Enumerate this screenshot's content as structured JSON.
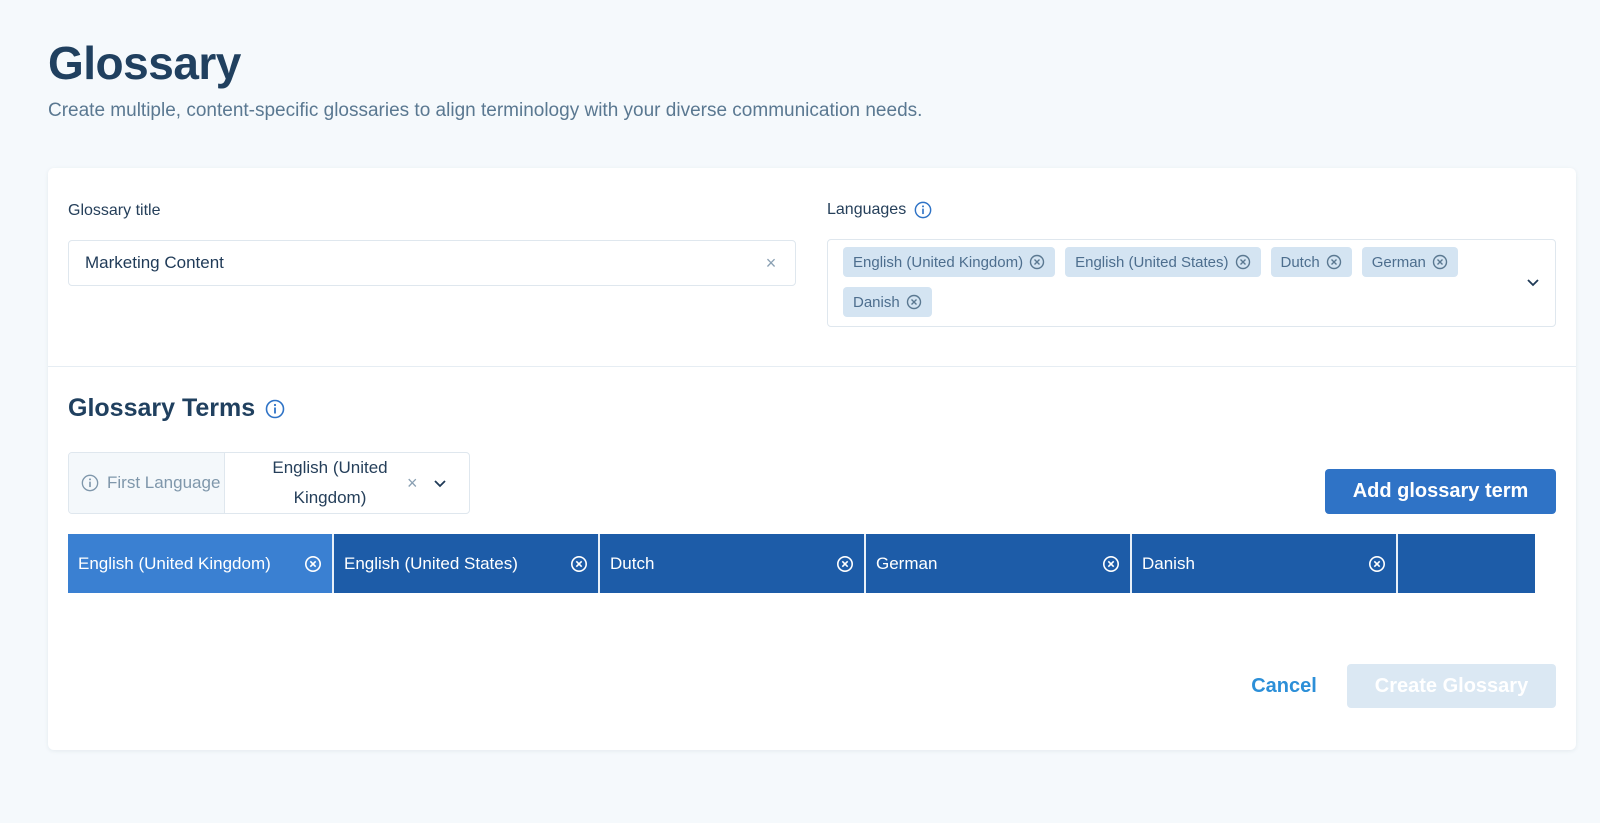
{
  "header": {
    "title": "Glossary",
    "subtitle": "Create multiple, content-specific glossaries to align terminology with your diverse communication needs."
  },
  "form": {
    "title_label": "Glossary title",
    "title_value": "Marketing Content",
    "languages_label": "Languages",
    "languages": [
      "English (United Kingdom)",
      "English (United States)",
      "Dutch",
      "German",
      "Danish"
    ]
  },
  "terms": {
    "section_title": "Glossary Terms",
    "first_language_label": "First Language",
    "first_language_value": "English (United Kingdom)",
    "add_button": "Add glossary term",
    "columns": [
      "English (United Kingdom)",
      "English (United States)",
      "Dutch",
      "German",
      "Danish"
    ]
  },
  "footer": {
    "cancel_label": "Cancel",
    "create_label": "Create Glossary"
  },
  "icons": {
    "clear": "×",
    "info": "info-icon",
    "chip_remove": "circle-x-icon",
    "chevron": "chevron-down-icon"
  },
  "colors": {
    "accent": "#2f73c6",
    "header_dark": "#1d5ca8",
    "header_active": "#3a80d2",
    "chip_bg": "#d4e4f2",
    "disabled_btn": "#dbe8f3",
    "link": "#2c8fd8"
  }
}
